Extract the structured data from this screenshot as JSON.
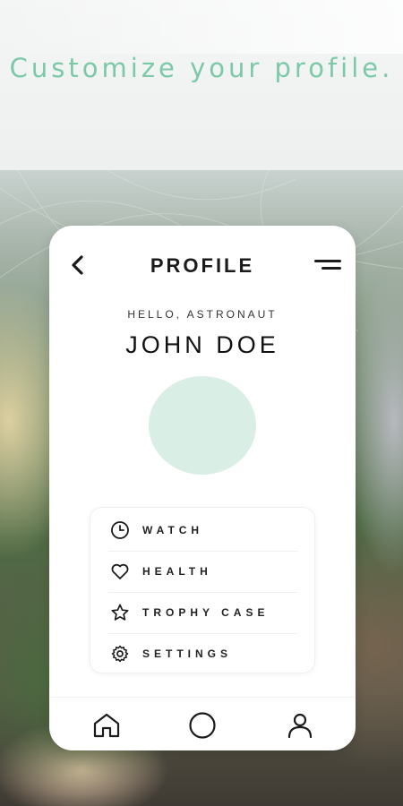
{
  "tagline": "Customize your profile.",
  "profile": {
    "title": "PROFILE",
    "greeting": "HELLO, ASTRONAUT",
    "name": "JOHN DOE",
    "avatar_color": "#d9efe6"
  },
  "menu": [
    {
      "label": "WATCH",
      "icon": "clock-icon"
    },
    {
      "label": "HEALTH",
      "icon": "heart-icon"
    },
    {
      "label": "TROPHY CASE",
      "icon": "star-icon"
    },
    {
      "label": "SETTINGS",
      "icon": "gear-icon"
    }
  ],
  "nav": [
    {
      "icon": "home-icon"
    },
    {
      "icon": "circle-icon"
    },
    {
      "icon": "user-icon"
    }
  ],
  "colors": {
    "accent": "#7cc9a8",
    "text": "#1b1b1b",
    "card": "#ffffff"
  }
}
